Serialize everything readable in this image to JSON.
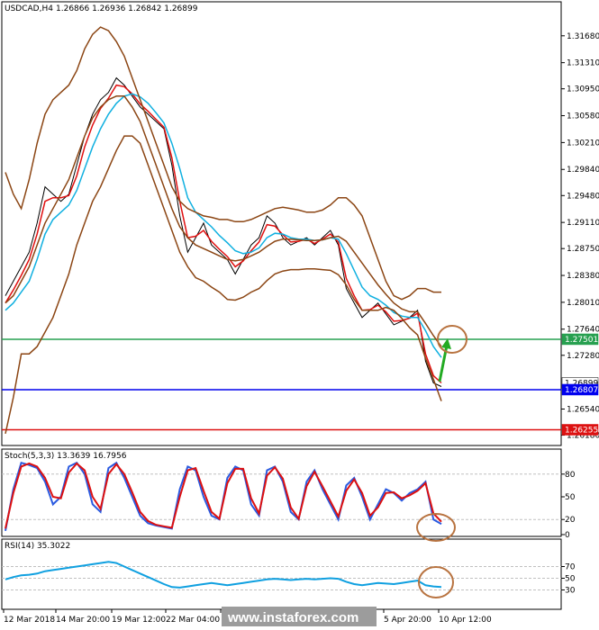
{
  "header": {
    "symbol": "USDCAD,H4",
    "ohlc": "1.26866 1.26936 1.26842 1.26899"
  },
  "stoch_label": "Stoch(5,3,3) 13.3639 16.7956",
  "rsi_label": "RSI(14) 35.3022",
  "watermark": "www.instaforex.com",
  "chart_data": [
    {
      "type": "candlestick",
      "title": "USDCAD,H4",
      "y_ticks": [
        "1.31680",
        "1.31310",
        "1.30950",
        "1.30580",
        "1.30210",
        "1.29840",
        "1.29480",
        "1.29110",
        "1.28750",
        "1.28380",
        "1.28010",
        "1.27640",
        "1.27280",
        "1.26540",
        "1.26180"
      ],
      "ylim": [
        1.261,
        1.3195
      ],
      "price_tags": [
        {
          "label": "1.26899",
          "value": 1.26899,
          "color": "#ffffff"
        },
        {
          "label": "1.27501",
          "value": 1.27501,
          "color": "#27a050"
        },
        {
          "label": "1.26807",
          "value": 1.26807,
          "color": "#0000ee"
        },
        {
          "label": "1.26255",
          "value": 1.26255,
          "color": "#dd1111"
        }
      ],
      "horizontal_lines": [
        {
          "value": 1.27501,
          "color": "#27a050"
        },
        {
          "value": 1.26807,
          "color": "#0000ee"
        },
        {
          "value": 1.26255,
          "color": "#dd1111"
        }
      ],
      "x_ticks": [
        "12 Mar 2018",
        "14 Mar 20:00",
        "19 Mar 12:00",
        "22 Mar 04:00",
        "",
        "",
        "",
        "5 Apr 20:00",
        "10 Apr 12:00"
      ],
      "series": [
        {
          "name": "",
          "color": "#000000",
          "values": [
            1.281,
            1.283,
            1.285,
            1.287,
            1.291,
            1.296,
            1.295,
            1.294,
            1.295,
            1.299,
            1.303,
            1.306,
            1.308,
            1.309,
            1.311,
            1.31,
            1.3085,
            1.307,
            1.306,
            1.305,
            1.304,
            1.299,
            1.292,
            1.287,
            1.289,
            1.291,
            1.288,
            1.287,
            1.286,
            1.284,
            1.286,
            1.288,
            1.289,
            1.292,
            1.291,
            1.289,
            1.288,
            1.2885,
            1.289,
            1.288,
            1.289,
            1.29,
            1.288,
            1.282,
            1.28,
            1.278,
            1.279,
            1.28,
            1.2785,
            1.277,
            1.2775,
            1.278,
            1.279,
            1.272,
            1.269,
            1.2685
          ]
        },
        {
          "name": "",
          "color": "#e01010",
          "values": [
            1.28,
            1.2818,
            1.2838,
            1.286,
            1.2895,
            1.294,
            1.2945,
            1.2945,
            1.2948,
            1.2975,
            1.3015,
            1.3045,
            1.3068,
            1.3082,
            1.31,
            1.3098,
            1.3088,
            1.3074,
            1.3064,
            1.3053,
            1.3042,
            1.3,
            1.294,
            1.289,
            1.2892,
            1.29,
            1.2885,
            1.2874,
            1.2864,
            1.285,
            1.2858,
            1.2872,
            1.2884,
            1.2908,
            1.2906,
            1.2894,
            1.2884,
            1.2885,
            1.2888,
            1.2882,
            1.2888,
            1.2895,
            1.2884,
            1.2834,
            1.281,
            1.279,
            1.2791,
            1.2797,
            1.2788,
            1.2775,
            1.2776,
            1.2779,
            1.2786,
            1.273,
            1.27,
            1.269
          ]
        },
        {
          "name": "",
          "color": "#10b0e0",
          "values": [
            1.279,
            1.28,
            1.2815,
            1.283,
            1.286,
            1.2895,
            1.2915,
            1.2925,
            1.2935,
            1.2955,
            1.2985,
            1.3015,
            1.304,
            1.306,
            1.3075,
            1.3085,
            1.3088,
            1.3084,
            1.3075,
            1.3062,
            1.3048,
            1.302,
            1.2985,
            1.2945,
            1.2925,
            1.2915,
            1.2905,
            1.2893,
            1.2883,
            1.2872,
            1.2868,
            1.287,
            1.2876,
            1.289,
            1.2896,
            1.2895,
            1.289,
            1.2888,
            1.2888,
            1.2886,
            1.2887,
            1.289,
            1.2888,
            1.2868,
            1.2845,
            1.2822,
            1.281,
            1.2805,
            1.2797,
            1.2787,
            1.2782,
            1.278,
            1.278,
            1.2762,
            1.274,
            1.2725
          ]
        },
        {
          "name": "",
          "color": "#8b4513",
          "values": [
            1.298,
            1.295,
            1.293,
            1.297,
            1.302,
            1.306,
            1.308,
            1.309,
            1.31,
            1.312,
            1.315,
            1.317,
            1.318,
            1.3175,
            1.316,
            1.314,
            1.311,
            1.308,
            1.305,
            1.302,
            1.299,
            1.296,
            1.294,
            1.293,
            1.2925,
            1.292,
            1.2918,
            1.2915,
            1.2915,
            1.2912,
            1.2912,
            1.2915,
            1.292,
            1.2925,
            1.293,
            1.2932,
            1.293,
            1.2928,
            1.2925,
            1.2925,
            1.2928,
            1.2935,
            1.2945,
            1.2945,
            1.2935,
            1.292,
            1.289,
            1.286,
            1.283,
            1.281,
            1.2805,
            1.281,
            1.282,
            1.282,
            1.2815,
            1.2815
          ]
        },
        {
          "name": "",
          "color": "#8b4513",
          "values": [
            1.28,
            1.281,
            1.283,
            1.285,
            1.288,
            1.291,
            1.293,
            1.295,
            1.297,
            1.3,
            1.303,
            1.3055,
            1.307,
            1.308,
            1.3085,
            1.3085,
            1.307,
            1.305,
            1.302,
            1.299,
            1.296,
            1.293,
            1.2905,
            1.289,
            1.288,
            1.2875,
            1.287,
            1.2865,
            1.286,
            1.2858,
            1.286,
            1.2865,
            1.287,
            1.2878,
            1.2885,
            1.2888,
            1.2888,
            1.2887,
            1.2886,
            1.2886,
            1.2887,
            1.289,
            1.2892,
            1.2885,
            1.287,
            1.2855,
            1.284,
            1.2825,
            1.2812,
            1.28,
            1.2792,
            1.2788,
            1.2788,
            1.2772,
            1.2755,
            1.274
          ]
        },
        {
          "name": "",
          "color": "#8b4513",
          "values": [
            1.262,
            1.267,
            1.273,
            1.273,
            1.274,
            1.276,
            1.278,
            1.281,
            1.284,
            1.288,
            1.291,
            1.294,
            1.296,
            1.2985,
            1.301,
            1.303,
            1.303,
            1.302,
            1.299,
            1.296,
            1.293,
            1.29,
            1.287,
            1.285,
            1.2835,
            1.283,
            1.2822,
            1.2815,
            1.2805,
            1.2804,
            1.2808,
            1.2815,
            1.282,
            1.2831,
            1.284,
            1.2844,
            1.2846,
            1.2846,
            1.2847,
            1.2847,
            1.2846,
            1.2845,
            1.2839,
            1.2825,
            1.2805,
            1.279,
            1.279,
            1.279,
            1.2794,
            1.279,
            1.2779,
            1.2766,
            1.2756,
            1.2724,
            1.2695,
            1.2665
          ]
        }
      ]
    },
    {
      "type": "line",
      "title": "Stoch(5,3,3) 13.3639 16.7956",
      "y_ticks": [
        "80",
        "50",
        "20",
        "0"
      ],
      "ylim": [
        0,
        100
      ],
      "levels": [
        80,
        20
      ],
      "series": [
        {
          "name": "",
          "color": "#2a5ae0",
          "values": [
            5,
            60,
            95,
            92,
            88,
            70,
            40,
            50,
            90,
            95,
            80,
            40,
            30,
            88,
            95,
            75,
            50,
            25,
            15,
            12,
            10,
            8,
            60,
            90,
            85,
            50,
            25,
            20,
            75,
            90,
            85,
            40,
            25,
            85,
            90,
            70,
            30,
            20,
            70,
            85,
            60,
            40,
            20,
            65,
            75,
            50,
            20,
            40,
            60,
            55,
            45,
            55,
            60,
            70,
            20,
            14
          ]
        },
        {
          "name": "",
          "color": "#dd1010",
          "values": [
            8,
            55,
            90,
            94,
            90,
            75,
            50,
            48,
            82,
            94,
            85,
            50,
            34,
            80,
            93,
            80,
            56,
            30,
            18,
            13,
            11,
            9,
            50,
            85,
            88,
            58,
            30,
            21,
            68,
            87,
            87,
            48,
            28,
            78,
            89,
            74,
            36,
            21,
            64,
            83,
            64,
            44,
            24,
            58,
            73,
            55,
            25,
            36,
            55,
            56,
            48,
            52,
            58,
            68,
            28,
            17
          ]
        }
      ]
    },
    {
      "type": "line",
      "title": "RSI(14) 35.3022",
      "y_ticks": [
        "70",
        "50",
        "30"
      ],
      "ylim": [
        0,
        100
      ],
      "levels": [
        70,
        50,
        30
      ],
      "series": [
        {
          "name": "",
          "color": "#10a0e0",
          "values": [
            48,
            52,
            55,
            56,
            58,
            62,
            64,
            66,
            68,
            70,
            72,
            74,
            76,
            78,
            76,
            70,
            64,
            58,
            52,
            46,
            40,
            35,
            34,
            36,
            38,
            40,
            42,
            40,
            38,
            40,
            42,
            44,
            46,
            48,
            49,
            48,
            47,
            48,
            49,
            48,
            49,
            50,
            49,
            44,
            40,
            38,
            40,
            42,
            41,
            40,
            42,
            44,
            46,
            38,
            36,
            35
          ]
        }
      ]
    }
  ]
}
